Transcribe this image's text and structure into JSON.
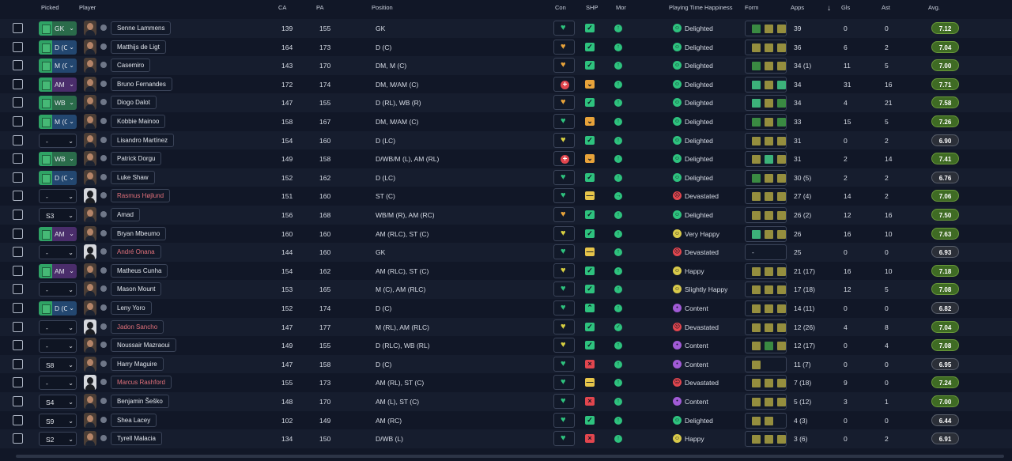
{
  "headers": {
    "picked": "Picked",
    "player": "Player",
    "ca": "CA",
    "pa": "PA",
    "position": "Position",
    "con": "Con",
    "shp": "SHP",
    "mor": "Mor",
    "pth": "Playing Time Happiness",
    "form": "Form",
    "apps": "Apps",
    "gls": "Gls",
    "ast": "Ast",
    "avg": "Avg."
  },
  "colors": {
    "heart_green": "#2ec27e",
    "heart_yellow": "#d8d041",
    "heart_orange": "#e8a33a",
    "shp_green": "#2ec27e",
    "shp_orange": "#e8a33a",
    "shp_yellow": "#e7c54a",
    "shp_red": "#e2464e",
    "happy_green": "#2ec27e",
    "happy_yellow": "#d8c94a",
    "happy_purple": "#a15bd6",
    "happy_red": "#e2464e",
    "avg_green": "#3f6b24",
    "avg_dark": "#2b2f38",
    "form_olive": "#958e3e",
    "form_green": "#3a8a42",
    "form_bright": "#3cb27a"
  },
  "players": [
    {
      "picked": "GK",
      "picked_type": "pos",
      "name": "Senne Lammens",
      "name_red": false,
      "ca": "139",
      "pa": "155",
      "position": "GK",
      "con": "heart-green",
      "shp": "green",
      "mor_icon": "up",
      "pth_icon": "green",
      "pth": "Delighted",
      "form": [
        "green",
        "olive",
        "olive"
      ],
      "apps": "39",
      "gls": "0",
      "ast": "0",
      "avg": "7.12",
      "avg_style": "green"
    },
    {
      "picked": "D (C",
      "picked_type": "pos",
      "name": "Matthijs de Ligt",
      "name_red": false,
      "ca": "164",
      "pa": "173",
      "position": "D (C)",
      "con": "heart-orange",
      "shp": "green",
      "mor_icon": "up",
      "pth_icon": "green",
      "pth": "Delighted",
      "form": [
        "olive",
        "olive",
        "olive"
      ],
      "apps": "36",
      "gls": "6",
      "ast": "2",
      "avg": "7.04",
      "avg_style": "green"
    },
    {
      "picked": "M (C",
      "picked_type": "pos",
      "name": "Casemiro",
      "name_red": false,
      "ca": "143",
      "pa": "170",
      "position": "DM, M (C)",
      "con": "heart-orange",
      "shp": "green",
      "mor_icon": "up",
      "pth_icon": "green",
      "pth": "Delighted",
      "form": [
        "green",
        "olive",
        "olive"
      ],
      "apps": "34 (1)",
      "gls": "11",
      "ast": "5",
      "avg": "7.00",
      "avg_style": "green"
    },
    {
      "picked": "AM",
      "picked_type": "pos",
      "name": "Bruno Fernandes",
      "name_red": false,
      "ca": "172",
      "pa": "174",
      "position": "DM, M/AM (C)",
      "con": "plus",
      "shp": "orange",
      "mor_icon": "up",
      "pth_icon": "green",
      "pth": "Delighted",
      "form": [
        "bright",
        "olive",
        "bright"
      ],
      "apps": "34",
      "gls": "31",
      "ast": "16",
      "avg": "7.71",
      "avg_style": "green"
    },
    {
      "picked": "WB",
      "picked_type": "pos",
      "name": "Diogo Dalot",
      "name_red": false,
      "ca": "147",
      "pa": "155",
      "position": "D (RL), WB (R)",
      "con": "heart-orange",
      "shp": "green",
      "mor_icon": "up",
      "pth_icon": "green",
      "pth": "Delighted",
      "form": [
        "bright",
        "olive",
        "green"
      ],
      "apps": "34",
      "gls": "4",
      "ast": "21",
      "avg": "7.58",
      "avg_style": "green"
    },
    {
      "picked": "M (C",
      "picked_type": "pos",
      "name": "Kobbie Mainoo",
      "name_red": false,
      "ca": "158",
      "pa": "167",
      "position": "DM, M/AM (C)",
      "con": "heart-green",
      "shp": "orange",
      "mor_icon": "up",
      "pth_icon": "green",
      "pth": "Delighted",
      "form": [
        "green",
        "olive",
        "green"
      ],
      "apps": "33",
      "gls": "15",
      "ast": "5",
      "avg": "7.26",
      "avg_style": "green"
    },
    {
      "picked": "-",
      "picked_type": "plain",
      "name": "Lisandro Martínez",
      "name_red": false,
      "ca": "154",
      "pa": "160",
      "position": "D (LC)",
      "con": "heart-yellow",
      "shp": "green",
      "mor_icon": "up",
      "pth_icon": "green",
      "pth": "Delighted",
      "form": [
        "olive",
        "olive",
        "olive"
      ],
      "apps": "31",
      "gls": "0",
      "ast": "2",
      "avg": "6.90",
      "avg_style": "dark"
    },
    {
      "picked": "WB",
      "picked_type": "pos",
      "name": "Patrick Dorgu",
      "name_red": false,
      "ca": "149",
      "pa": "158",
      "position": "D/WB/M (L), AM (RL)",
      "con": "plus",
      "shp": "orange",
      "mor_icon": "up",
      "pth_icon": "green",
      "pth": "Delighted",
      "form": [
        "olive",
        "bright",
        "olive"
      ],
      "apps": "31",
      "gls": "2",
      "ast": "14",
      "avg": "7.41",
      "avg_style": "green"
    },
    {
      "picked": "D (C",
      "picked_type": "pos",
      "name": "Luke Shaw",
      "name_red": false,
      "ca": "152",
      "pa": "162",
      "position": "D (LC)",
      "con": "heart-green",
      "shp": "green",
      "mor_icon": "up",
      "pth_icon": "green",
      "pth": "Delighted",
      "form": [
        "green",
        "olive",
        "olive"
      ],
      "apps": "30 (5)",
      "gls": "2",
      "ast": "2",
      "avg": "6.76",
      "avg_style": "dark"
    },
    {
      "picked": "-",
      "picked_type": "plain",
      "name": "Rasmus Højlund",
      "name_red": true,
      "ca": "151",
      "pa": "160",
      "position": "ST (C)",
      "con": "heart-green",
      "shp": "yellow",
      "mor_icon": "right",
      "pth_icon": "red",
      "pth": "Devastated",
      "form": [
        "olive",
        "olive",
        "olive"
      ],
      "apps": "27 (4)",
      "gls": "14",
      "ast": "2",
      "avg": "7.06",
      "avg_style": "green"
    },
    {
      "picked": "S3",
      "picked_type": "plain",
      "name": "Amad",
      "name_red": false,
      "ca": "156",
      "pa": "168",
      "position": "WB/M (R), AM (RC)",
      "con": "heart-orange",
      "shp": "green",
      "mor_icon": "up",
      "pth_icon": "green",
      "pth": "Delighted",
      "form": [
        "olive",
        "olive",
        "olive"
      ],
      "apps": "26 (2)",
      "gls": "12",
      "ast": "16",
      "avg": "7.50",
      "avg_style": "green"
    },
    {
      "picked": "AM",
      "picked_type": "pos",
      "name": "Bryan Mbeumo",
      "name_red": false,
      "ca": "160",
      "pa": "160",
      "position": "AM (RLC), ST (C)",
      "con": "heart-yellow",
      "shp": "green",
      "mor_icon": "up",
      "pth_icon": "yellow",
      "pth": "Very Happy",
      "form": [
        "bright",
        "olive",
        "olive"
      ],
      "apps": "26",
      "gls": "16",
      "ast": "10",
      "avg": "7.63",
      "avg_style": "green"
    },
    {
      "picked": "-",
      "picked_type": "plain",
      "name": "André Onana",
      "name_red": true,
      "ca": "144",
      "pa": "160",
      "position": "GK",
      "con": "heart-green",
      "shp": "yellow",
      "mor_icon": "up",
      "pth_icon": "red",
      "pth": "Devastated",
      "form": [
        "dash"
      ],
      "apps": "25",
      "gls": "0",
      "ast": "0",
      "avg": "6.93",
      "avg_style": "dark"
    },
    {
      "picked": "AM",
      "picked_type": "pos",
      "name": "Matheus Cunha",
      "name_red": false,
      "ca": "154",
      "pa": "162",
      "position": "AM (RLC), ST (C)",
      "con": "heart-yellow",
      "shp": "green",
      "mor_icon": "up",
      "pth_icon": "yellow",
      "pth": "Happy",
      "form": [
        "olive",
        "olive",
        "olive"
      ],
      "apps": "21 (17)",
      "gls": "16",
      "ast": "10",
      "avg": "7.18",
      "avg_style": "green"
    },
    {
      "picked": "-",
      "picked_type": "plain",
      "name": "Mason Mount",
      "name_red": false,
      "ca": "153",
      "pa": "165",
      "position": "M (C), AM (RLC)",
      "con": "heart-green",
      "shp": "green",
      "mor_icon": "up",
      "pth_icon": "yellow",
      "pth": "Slightly Happy",
      "form": [
        "olive",
        "olive",
        "olive"
      ],
      "apps": "17 (18)",
      "gls": "12",
      "ast": "5",
      "avg": "7.08",
      "avg_style": "green"
    },
    {
      "picked": "D (C",
      "picked_type": "pos",
      "name": "Leny Yoro",
      "name_red": false,
      "ca": "152",
      "pa": "174",
      "position": "D (C)",
      "con": "heart-green",
      "shp": "chev",
      "mor_icon": "up",
      "pth_icon": "purple",
      "pth": "Content",
      "form": [
        "olive",
        "olive",
        "olive"
      ],
      "apps": "14 (11)",
      "gls": "0",
      "ast": "0",
      "avg": "6.82",
      "avg_style": "dark"
    },
    {
      "picked": "-",
      "picked_type": "plain",
      "name": "Jadon Sancho",
      "name_red": true,
      "ca": "147",
      "pa": "177",
      "position": "M (RL), AM (RLC)",
      "con": "heart-yellow",
      "shp": "green",
      "mor_icon": "check",
      "pth_icon": "red",
      "pth": "Devastated",
      "form": [
        "olive",
        "olive",
        "olive"
      ],
      "apps": "12 (26)",
      "gls": "4",
      "ast": "8",
      "avg": "7.04",
      "avg_style": "green"
    },
    {
      "picked": "-",
      "picked_type": "plain",
      "name": "Noussair Mazraoui",
      "name_red": false,
      "ca": "149",
      "pa": "155",
      "position": "D (RLC), WB (RL)",
      "con": "heart-yellow",
      "shp": "green",
      "mor_icon": "up",
      "pth_icon": "purple",
      "pth": "Content",
      "form": [
        "olive",
        "green",
        "olive"
      ],
      "apps": "12 (17)",
      "gls": "0",
      "ast": "4",
      "avg": "7.08",
      "avg_style": "green"
    },
    {
      "picked": "S8",
      "picked_type": "plain",
      "name": "Harry Maguire",
      "name_red": false,
      "ca": "147",
      "pa": "158",
      "position": "D (C)",
      "con": "heart-green",
      "shp": "red",
      "mor_icon": "up",
      "pth_icon": "purple",
      "pth": "Content",
      "form": [
        "olive"
      ],
      "apps": "11 (7)",
      "gls": "0",
      "ast": "0",
      "avg": "6.95",
      "avg_style": "dark"
    },
    {
      "picked": "-",
      "picked_type": "plain",
      "name": "Marcus Rashford",
      "name_red": true,
      "ca": "155",
      "pa": "173",
      "position": "AM (RL), ST (C)",
      "con": "heart-green",
      "shp": "yellow",
      "mor_icon": "up",
      "pth_icon": "red",
      "pth": "Devastated",
      "form": [
        "olive",
        "olive",
        "olive"
      ],
      "apps": "7 (18)",
      "gls": "9",
      "ast": "0",
      "avg": "7.24",
      "avg_style": "green"
    },
    {
      "picked": "S4",
      "picked_type": "plain",
      "name": "Benjamin Šeško",
      "name_red": false,
      "ca": "148",
      "pa": "170",
      "position": "AM (L), ST (C)",
      "con": "heart-green",
      "shp": "red",
      "mor_icon": "up",
      "pth_icon": "purple",
      "pth": "Content",
      "form": [
        "olive",
        "olive",
        "olive"
      ],
      "apps": "5 (12)",
      "gls": "3",
      "ast": "1",
      "avg": "7.00",
      "avg_style": "green"
    },
    {
      "picked": "S9",
      "picked_type": "plain",
      "name": "Shea Lacey",
      "name_red": false,
      "ca": "102",
      "pa": "149",
      "position": "AM (RC)",
      "con": "heart-green",
      "shp": "green",
      "mor_icon": "up",
      "pth_icon": "green",
      "pth": "Delighted",
      "form": [
        "olive",
        "olive"
      ],
      "apps": "4 (3)",
      "gls": "0",
      "ast": "0",
      "avg": "6.44",
      "avg_style": "dark"
    },
    {
      "picked": "S2",
      "picked_type": "plain",
      "name": "Tyrell Malacia",
      "name_red": false,
      "ca": "134",
      "pa": "150",
      "position": "D/WB (L)",
      "con": "heart-green",
      "shp": "red",
      "mor_icon": "up",
      "pth_icon": "yellow",
      "pth": "Happy",
      "form": [
        "olive",
        "olive",
        "olive"
      ],
      "apps": "3 (6)",
      "gls": "0",
      "ast": "2",
      "avg": "6.91",
      "avg_style": "dark"
    }
  ]
}
